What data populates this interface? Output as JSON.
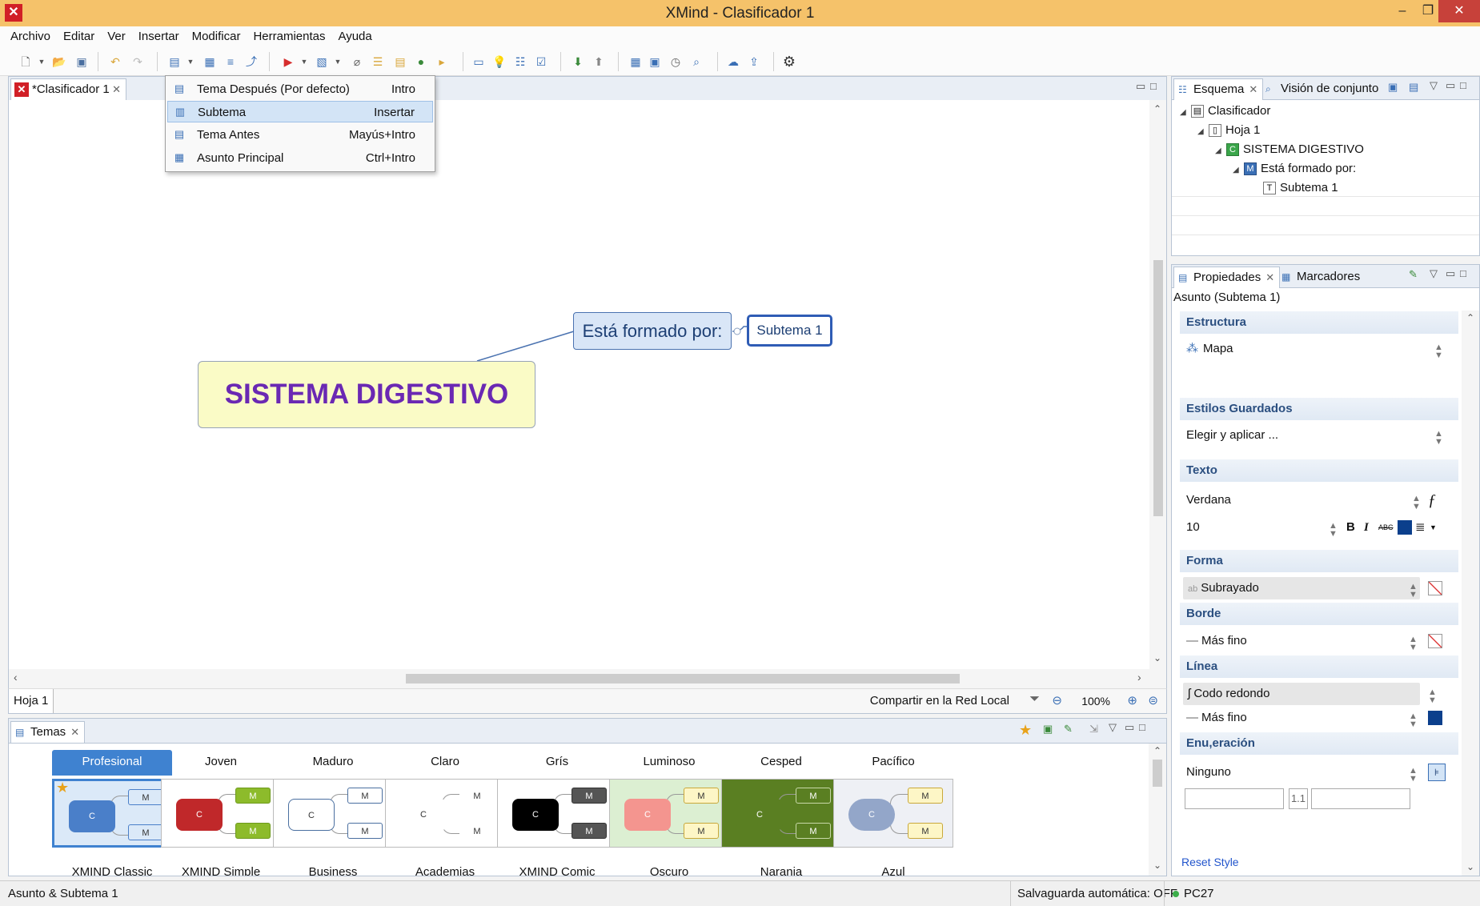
{
  "window": {
    "title": "XMind - Clasificador 1",
    "minimize": "–",
    "restore": "❐",
    "close": "✕"
  },
  "menu": [
    "Archivo",
    "Editar",
    "Ver",
    "Insertar",
    "Modificar",
    "Herramientas",
    "Ayuda"
  ],
  "editor": {
    "tab_label": "*Clasificador 1",
    "sheet_tab": "Hoja 1",
    "share_label": "Compartir en la Red Local",
    "zoom": "100%"
  },
  "mindmap": {
    "central": "SISTEMA DIGESTIVO",
    "main_topic": "Está formado por:",
    "subtopic": "Subtema 1"
  },
  "dropdown": {
    "items": [
      {
        "label": "Tema Después (Por defecto)",
        "shortcut": "Intro"
      },
      {
        "label": "Subtema",
        "shortcut": "Insertar"
      },
      {
        "label": "Tema Antes",
        "shortcut": "Mayús+Intro"
      },
      {
        "label": "Asunto Principal",
        "shortcut": "Ctrl+Intro"
      }
    ]
  },
  "outline": {
    "tabs": [
      "Esquema",
      "Visión de conjunto"
    ],
    "tree": [
      {
        "label": "Clasificador",
        "icon": "workbook-icon",
        "glyph": "▤"
      },
      {
        "label": "Hoja 1",
        "icon": "sheet-icon",
        "glyph": "▯"
      },
      {
        "label": "SISTEMA DIGESTIVO",
        "icon": "central-topic-icon",
        "glyph": "C"
      },
      {
        "label": "Está formado por:",
        "icon": "main-topic-icon",
        "glyph": "M"
      },
      {
        "label": "Subtema 1",
        "icon": "subtopic-icon",
        "glyph": "T"
      }
    ]
  },
  "properties": {
    "tabs": [
      "Propiedades",
      "Marcadores"
    ],
    "subtitle": "Asunto (Subtema 1)",
    "structure": {
      "header": "Estructura",
      "value": "Mapa"
    },
    "saved_styles": {
      "header": "Estilos Guardados",
      "value": "Elegir y aplicar ..."
    },
    "text": {
      "header": "Texto",
      "font": "Verdana",
      "size": "10",
      "bold": "B",
      "italic": "I",
      "strike": "ABC",
      "color": "#0b3f8c"
    },
    "shape": {
      "header": "Forma",
      "value": "Subrayado"
    },
    "border": {
      "header": "Borde",
      "value": "Más fino"
    },
    "line": {
      "header": "Línea",
      "shape": "Codo redondo",
      "width": "Más fino",
      "color": "#0b3f8c"
    },
    "numbering": {
      "header": "Enu,eración",
      "value": "Ninguno",
      "separator": "1.1"
    },
    "reset": "Reset Style"
  },
  "themes": {
    "tab_label": "Temas",
    "items": [
      {
        "name": "Profesional",
        "sub": "XMIND Classic",
        "central": "#4a7fc9",
        "node": "#dbe9f8",
        "node_border": "#4a7fc9",
        "bg": "#dbe9f8",
        "selected": true
      },
      {
        "name": "Joven",
        "sub": "XMIND Simple",
        "central": "#c0282a",
        "node": "#8dbb2b",
        "node_border": "#6e9a1c",
        "bg": "#ffffff",
        "selected": false
      },
      {
        "name": "Maduro",
        "sub": "Business",
        "central": "#ffffff",
        "node": "#ffffff",
        "node_border": "#4a6fa0",
        "bg": "#ffffff",
        "selected": false
      },
      {
        "name": "Claro",
        "sub": "Academias",
        "central": "#ffffff",
        "node": "#ffffff",
        "node_border": "#ffffff",
        "bg": "#ffffff",
        "selected": false
      },
      {
        "name": "Grís",
        "sub": "XMIND Comic",
        "central": "#000000",
        "node": "#555555",
        "node_border": "#333333",
        "bg": "#ffffff",
        "selected": false
      },
      {
        "name": "Luminoso",
        "sub": "Oscuro",
        "central": "#f4958f",
        "node": "#fdf6c6",
        "node_border": "#c9a83a",
        "bg": "#dcefd2",
        "selected": false
      },
      {
        "name": "Cesped",
        "sub": "Naranja",
        "central": "#5a7f22",
        "node": "#5a7f22",
        "node_border": "#c8d9a8",
        "bg": "#5a7f22",
        "selected": false
      },
      {
        "name": "Pacífico",
        "sub": "Azul",
        "central": "#93a6c9",
        "node": "#fdf6c6",
        "node_border": "#c9a83a",
        "bg": "#eef0f5",
        "selected": false
      }
    ]
  },
  "statusbar": {
    "left": "Asunto & Subtema 1",
    "autosave": "Salvaguarda automática: OFF",
    "host": "PC27"
  }
}
